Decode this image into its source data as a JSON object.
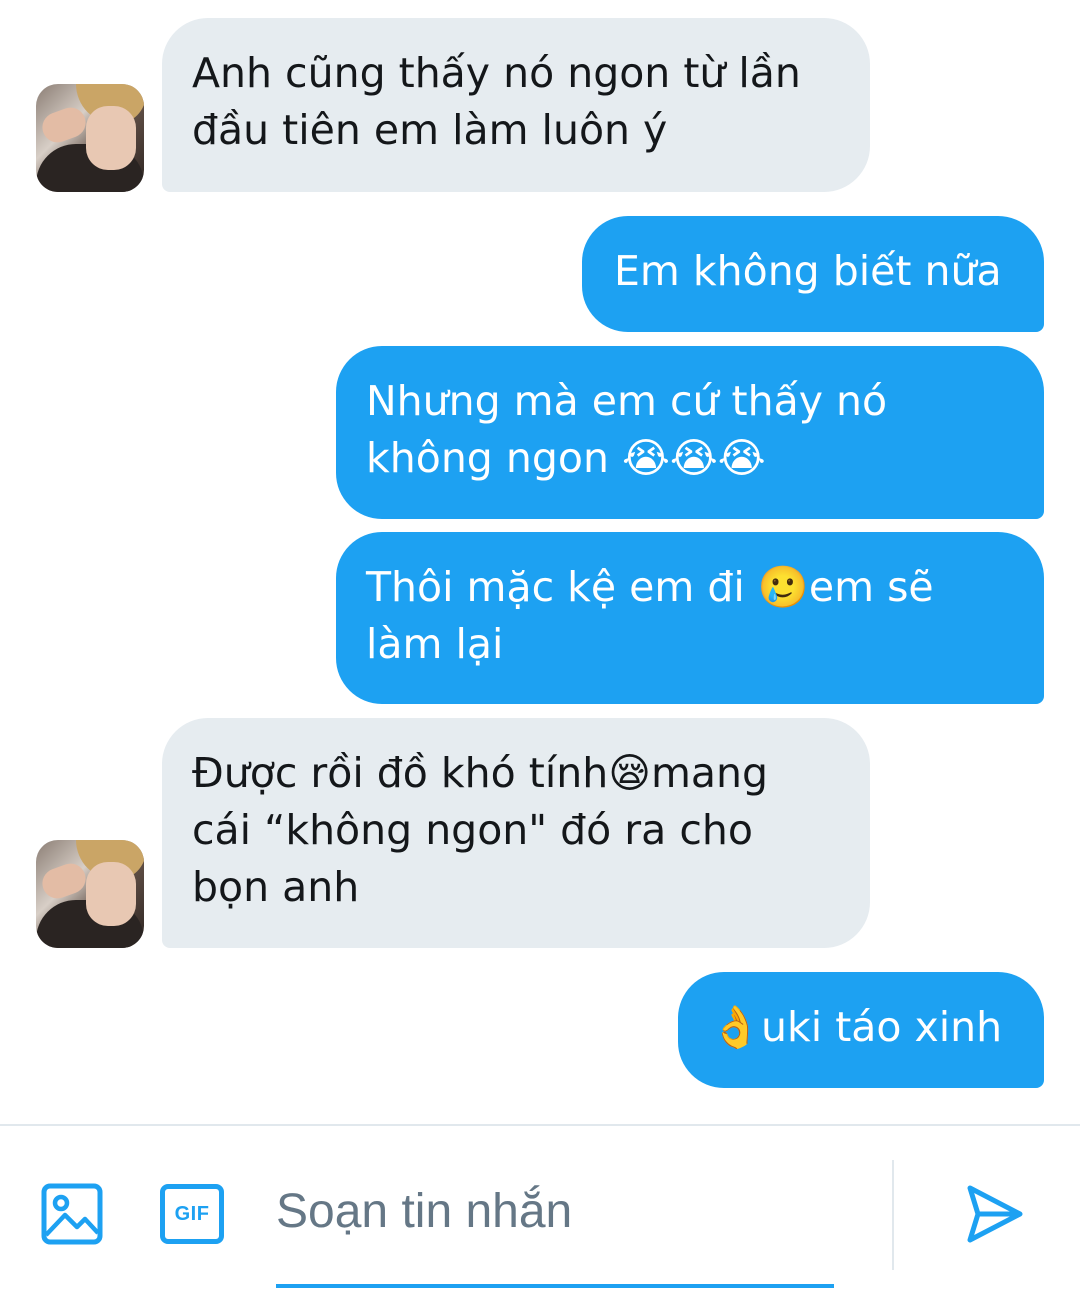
{
  "messages": [
    {
      "side": "in",
      "text": "Anh cũng thấy nó ngon từ lần\nđầu tiên em làm luôn ý"
    },
    {
      "side": "out",
      "text": "Em không biết nữa"
    },
    {
      "side": "out",
      "text": "Nhưng mà em cứ thấy nó\nkhông ngon 😭😭😭"
    },
    {
      "side": "out",
      "text": "Thôi mặc kệ em đi 🥲em sẽ\nlàm lại"
    },
    {
      "side": "in",
      "text": "Được rồi đồ khó tính😪mang\ncái “không ngon\" đó ra cho\nbọn anh"
    },
    {
      "side": "out",
      "text": "👌uki táo xinh"
    }
  ],
  "composer": {
    "placeholder": "Soạn tin nhắn",
    "gif_label": "GIF",
    "icons": {
      "image": "image-icon",
      "gif": "gif-icon",
      "send": "send-icon"
    }
  },
  "colors": {
    "outgoing_bubble": "#1da1f2",
    "incoming_bubble": "#e6ecf0",
    "accent": "#1da1f2"
  }
}
